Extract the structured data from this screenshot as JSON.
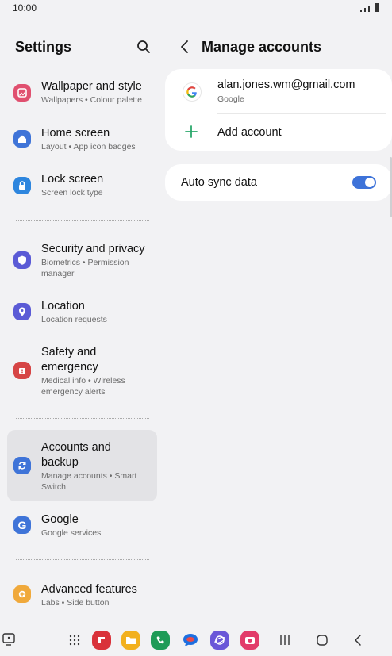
{
  "status_bar": {
    "time": "10:00"
  },
  "left_pane": {
    "title": "Settings",
    "items": [
      {
        "title": "Wallpaper and style",
        "subtitle": "Wallpapers • Colour palette",
        "icon": "wallpaper-icon",
        "color": "#e0506f"
      },
      {
        "title": "Home screen",
        "subtitle": "Layout • App icon badges",
        "icon": "home-icon",
        "color": "#3f74d8"
      },
      {
        "title": "Lock screen",
        "subtitle": "Screen lock type",
        "icon": "lock-icon",
        "color": "#2e86de"
      },
      {
        "title": "Security and privacy",
        "subtitle": "Biometrics • Permission manager",
        "icon": "shield-icon",
        "color": "#5b5bd6"
      },
      {
        "title": "Location",
        "subtitle": "Location requests",
        "icon": "location-pin-icon",
        "color": "#5b5bd6"
      },
      {
        "title": "Safety and emergency",
        "subtitle": "Medical info • Wireless emergency alerts",
        "icon": "emergency-icon",
        "color": "#d64545"
      },
      {
        "title": "Accounts and backup",
        "subtitle": "Manage accounts • Smart Switch",
        "icon": "sync-icon",
        "color": "#3f74d8"
      },
      {
        "title": "Google",
        "subtitle": "Google services",
        "icon": "google-icon",
        "color": "#3f74d8"
      },
      {
        "title": "Advanced features",
        "subtitle": "Labs • Side button",
        "icon": "gear-plus-icon",
        "color": "#f0a93b"
      }
    ]
  },
  "right_pane": {
    "title": "Manage accounts",
    "account": {
      "email": "alan.jones.wm@gmail.com",
      "provider": "Google"
    },
    "add_account_label": "Add account",
    "auto_sync": {
      "label": "Auto sync data",
      "enabled": true
    }
  },
  "colors": {
    "accent": "#3e73d9",
    "background": "#f2f2f4",
    "card": "#ffffff",
    "add_green": "#2aa86b"
  }
}
